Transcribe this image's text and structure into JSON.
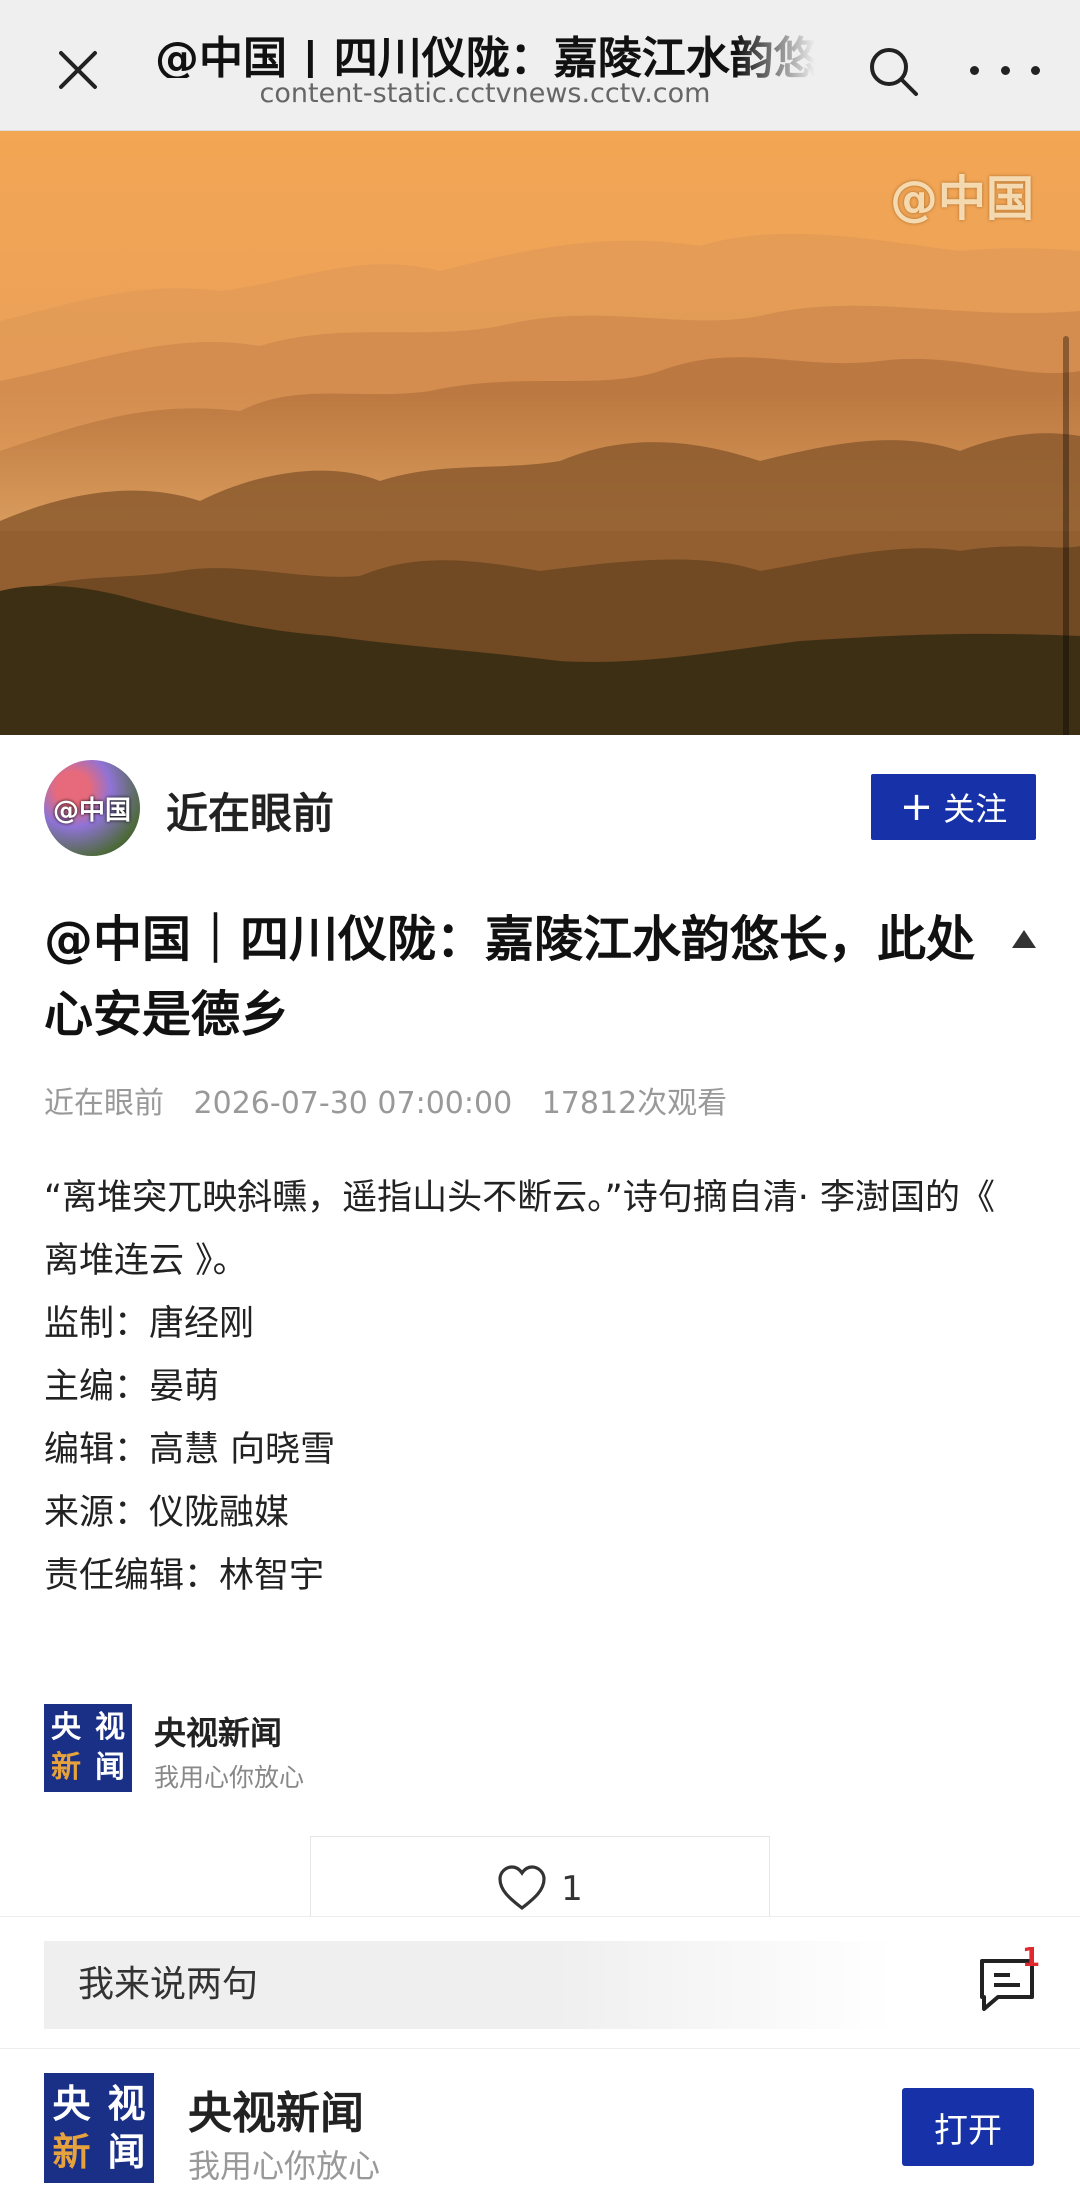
{
  "topbar": {
    "title": "@中国 | 四川仪陇：嘉陵江水韵悠长，此处心安是德乡",
    "url": "content-static.cctvnews.cctv.com",
    "close_icon": "close-icon",
    "search_icon": "search-icon",
    "more_icon": "more-icon"
  },
  "hero": {
    "watermark": "@中国",
    "colors": {
      "sky": "#f3a654",
      "mountain": "#8c5a2e",
      "forest": "#3d2f14"
    }
  },
  "author": {
    "avatar_text": "@中国",
    "name": "近在眼前",
    "follow_label": "关注",
    "follow_icon": "plus-icon"
  },
  "article": {
    "title": "@中国｜四川仪陇：嘉陵江水韵悠长，此处心安是德乡",
    "author": "近在眼前",
    "datetime": "2026-07-30 07:00:00",
    "views": "17812次观看",
    "body": [
      "“离堆突兀映斜曛，遥指山头不断云。”诗句摘自清· 李澍国的《 离堆连云 》。",
      "监制：唐经刚",
      "主编：晏萌",
      "编辑：高慧 向晓雪",
      "来源：仪陇融媒",
      "责任编辑：林智宇"
    ]
  },
  "source": {
    "logo_chars": [
      "央",
      "视",
      "新",
      "闻"
    ],
    "name": "央视新闻",
    "slogan": "我用心你放心"
  },
  "like": {
    "icon": "heart-icon",
    "count": "1"
  },
  "comment": {
    "placeholder": "我来说两句",
    "icon": "comment-icon",
    "badge": "1"
  },
  "appbar": {
    "logo_chars": [
      "央",
      "视",
      "新",
      "闻"
    ],
    "name": "央视新闻",
    "slogan": "我用心你放心",
    "open_label": "打开"
  },
  "colors": {
    "brand_blue": "#1732a8",
    "logo_blue": "#1a2f86",
    "badge_red": "#e0282e"
  }
}
